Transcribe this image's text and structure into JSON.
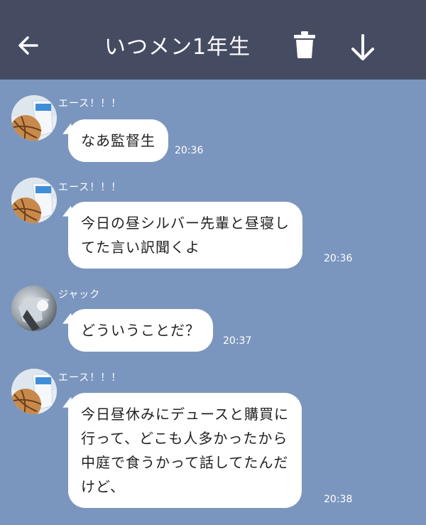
{
  "header": {
    "title": "いつメン1年生",
    "back_icon": "arrow-left-icon",
    "trash_icon": "trash-icon",
    "download_icon": "download-icon"
  },
  "colors": {
    "header_bg": "#454c62",
    "chat_bg": "#7b96be",
    "bubble_bg": "#ffffff"
  },
  "messages": [
    {
      "sender": "エース！！！",
      "text": "なあ監督生",
      "time": "20:36",
      "avatar": "ace-avatar"
    },
    {
      "sender": "エース！！！",
      "text": "今日の昼シルバー先輩と昼寝し\nてた言い訳聞くよ",
      "time": "20:36",
      "avatar": "ace-avatar"
    },
    {
      "sender": "ジャック",
      "text": "どういうことだ？",
      "time": "20:37",
      "avatar": "jack-avatar"
    },
    {
      "sender": "エース！！！",
      "text": "今日昼休みにデュースと購買に\n行って、どこも人多かったから\n中庭で食うかって話してたんだ\nけど、",
      "time": "20:38",
      "avatar": "ace-avatar"
    }
  ]
}
